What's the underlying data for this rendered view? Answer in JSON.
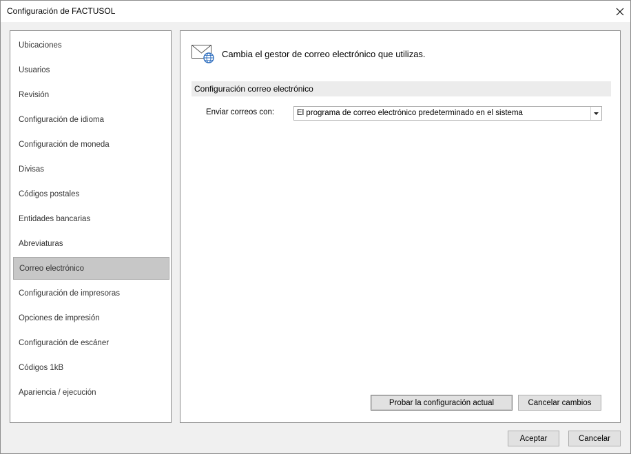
{
  "window": {
    "title": "Configuración de FACTUSOL",
    "close_icon": "close-icon"
  },
  "sidebar": {
    "selected_index": 9,
    "items": [
      {
        "label": "Ubicaciones"
      },
      {
        "label": "Usuarios"
      },
      {
        "label": "Revisión"
      },
      {
        "label": "Configuración de idioma"
      },
      {
        "label": "Configuración de moneda"
      },
      {
        "label": "Divisas"
      },
      {
        "label": "Códigos postales"
      },
      {
        "label": "Entidades bancarias"
      },
      {
        "label": "Abreviaturas"
      },
      {
        "label": "Correo electrónico"
      },
      {
        "label": "Configuración de impresoras"
      },
      {
        "label": "Opciones de impresión"
      },
      {
        "label": "Configuración de escáner"
      },
      {
        "label": "Códigos 1kB"
      },
      {
        "label": "Apariencia / ejecución"
      }
    ]
  },
  "main": {
    "header_icon": "envelope-globe-icon",
    "header_text": "Cambia el gestor de correo electrónico que utilizas.",
    "section_title": "Configuración correo electrónico",
    "send_with_label": "Enviar correos con:",
    "send_with_value": "El programa de correo electrónico predeterminado en el sistema",
    "test_button": "Probar la configuración actual",
    "cancel_changes_button": "Cancelar cambios"
  },
  "footer": {
    "accept_button": "Aceptar",
    "cancel_button": "Cancelar"
  },
  "colors": {
    "selected_item_bg": "#c7c7c7",
    "section_bar_bg": "#ececec",
    "button_bg": "#e1e1e1"
  }
}
